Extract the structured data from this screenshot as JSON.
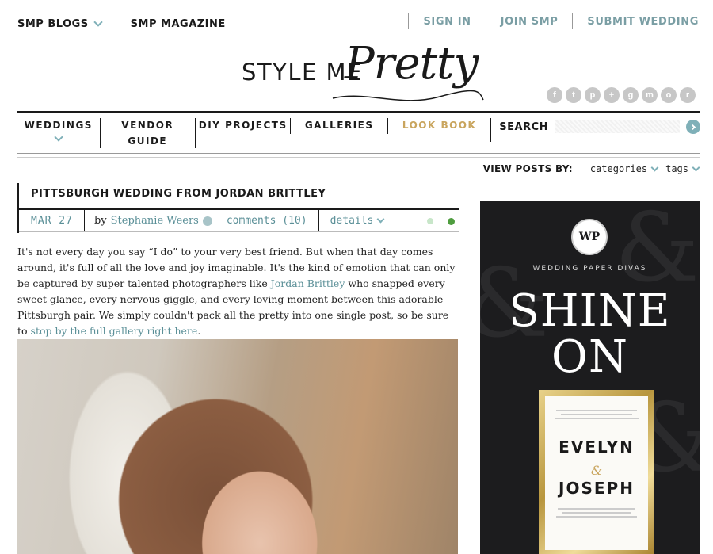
{
  "header": {
    "smp_blogs": "SMP BLOGS",
    "smp_magazine": "SMP MAGAZINE",
    "sign_in": "SIGN IN",
    "join_smp": "JOIN SMP",
    "submit_wedding": "SUBMIT WEDDING"
  },
  "logo": {
    "part1": "STYLE ME",
    "part2": "Pretty"
  },
  "social": [
    "f",
    "t",
    "p",
    "+",
    "g",
    "m",
    "o",
    "r"
  ],
  "nav": {
    "weddings": "WEDDINGS",
    "vendor_line1": "VENDOR",
    "vendor_line2": "GUIDE",
    "diy": "DIY PROJECTS",
    "galleries": "GALLERIES",
    "lookbook": "LOOK BOOK",
    "search_label": "SEARCH",
    "search_placeholder": ""
  },
  "view_posts": {
    "label": "VIEW POSTS BY:",
    "categories": "categories",
    "tags": "tags"
  },
  "post": {
    "title": "PITTSBURGH WEDDING FROM JORDAN BRITTLEY",
    "date": "MAR 27",
    "by": "by",
    "author": "Stephanie Weers",
    "comments": "comments (10)",
    "details": "details",
    "body_1": "It's not every day you say “I do” to your very best friend. But when that day comes around, it's full of all the love and joy imaginable. It's the kind of emotion that can only be captured by super talented photographers like ",
    "link_1": "Jordan Brittley",
    "body_2": " who snapped every sweet glance, every nervous giggle, and every loving moment between this adorable Pittsburgh pair. We simply couldn't pack all the pretty into one single post, so be sure to ",
    "link_2": "stop by the full gallery right here",
    "body_3": "."
  },
  "ad": {
    "logo_text": "WP",
    "brand": "WEDDING PAPER DIVAS",
    "headline_1": "SHINE",
    "headline_2": "ON",
    "name_1": "EVELYN",
    "amp": "&",
    "name_2": "JOSEPH"
  },
  "colors": {
    "accent": "#5a8f97",
    "gold": "#c9a55e",
    "dark": "#1a1a1a"
  }
}
